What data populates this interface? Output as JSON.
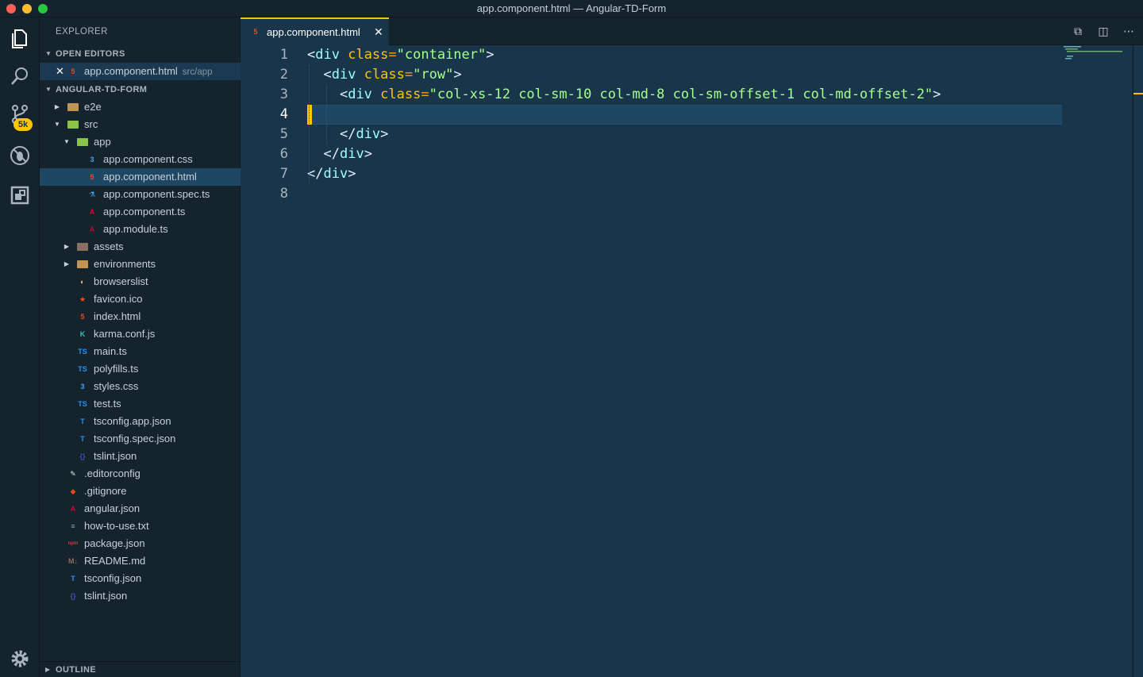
{
  "window": {
    "title": "app.component.html — Angular-TD-Form"
  },
  "activity_bar": {
    "items": [
      {
        "name": "explorer",
        "icon": "files-icon"
      },
      {
        "name": "search",
        "icon": "search-icon"
      },
      {
        "name": "source-control",
        "icon": "source-control-icon",
        "badge": "5k"
      },
      {
        "name": "debug",
        "icon": "debug-icon"
      },
      {
        "name": "extensions",
        "icon": "extensions-icon"
      }
    ],
    "manage_icon": "gear-icon"
  },
  "sidebar": {
    "title": "EXPLORER",
    "open_editors_header": "OPEN EDITORS",
    "open_editors": [
      {
        "name": "app.component.html",
        "desc": "src/app",
        "icon_text": "5",
        "icon_color": "#e44d26"
      }
    ],
    "project_header": "ANGULAR-TD-FORM",
    "outline_header": "OUTLINE",
    "tree": [
      {
        "label": "e2e",
        "depth": 1,
        "twisty": "▶",
        "icon": "folder-icon",
        "icon_text": "",
        "icon_color": "#c09553"
      },
      {
        "label": "src",
        "depth": 1,
        "twisty": "▼",
        "icon": "folder-open-icon",
        "icon_text": "",
        "icon_color": "#8bc34a"
      },
      {
        "label": "app",
        "depth": 2,
        "twisty": "▼",
        "icon": "folder-open-icon",
        "icon_text": "",
        "icon_color": "#8bc34a"
      },
      {
        "label": "app.component.css",
        "depth": 3,
        "icon": "css-icon",
        "icon_text": "3",
        "icon_color": "#42a5f5"
      },
      {
        "label": "app.component.html",
        "depth": 3,
        "icon": "html-icon",
        "icon_text": "5",
        "icon_color": "#e44d26",
        "selected": true
      },
      {
        "label": "app.component.spec.ts",
        "depth": 3,
        "icon": "test-icon",
        "icon_text": "⚗",
        "icon_color": "#42a5f5"
      },
      {
        "label": "app.component.ts",
        "depth": 3,
        "icon": "angular-icon",
        "icon_text": "A",
        "icon_color": "#dd0031"
      },
      {
        "label": "app.module.ts",
        "depth": 3,
        "icon": "angular-module-icon",
        "icon_text": "A",
        "icon_color": "#c3002f"
      },
      {
        "label": "assets",
        "depth": 2,
        "twisty": "▶",
        "icon": "folder-icon",
        "icon_text": "",
        "icon_color": "#8d6e63"
      },
      {
        "label": "environments",
        "depth": 2,
        "twisty": "▶",
        "icon": "folder-icon",
        "icon_text": "",
        "icon_color": "#c09553"
      },
      {
        "label": "browserslist",
        "depth": 2,
        "icon": "browserslist-icon",
        "icon_text": "◐",
        "icon_color": "#ffca28"
      },
      {
        "label": "favicon.ico",
        "depth": 2,
        "icon": "favicon-icon",
        "icon_text": "★",
        "icon_color": "#f4511e"
      },
      {
        "label": "index.html",
        "depth": 2,
        "icon": "html-icon",
        "icon_text": "5",
        "icon_color": "#e44d26"
      },
      {
        "label": "karma.conf.js",
        "depth": 2,
        "icon": "karma-icon",
        "icon_text": "K",
        "icon_color": "#3cbeae"
      },
      {
        "label": "main.ts",
        "depth": 2,
        "icon": "typescript-icon",
        "icon_text": "TS",
        "icon_color": "#2196f3"
      },
      {
        "label": "polyfills.ts",
        "depth": 2,
        "icon": "typescript-icon",
        "icon_text": "TS",
        "icon_color": "#2196f3"
      },
      {
        "label": "styles.css",
        "depth": 2,
        "icon": "css-icon",
        "icon_text": "3",
        "icon_color": "#42a5f5"
      },
      {
        "label": "test.ts",
        "depth": 2,
        "icon": "typescript-icon",
        "icon_text": "TS",
        "icon_color": "#2196f3"
      },
      {
        "label": "tsconfig.app.json",
        "depth": 2,
        "icon": "tsconfig-icon",
        "icon_text": "T",
        "icon_color": "#2196f3"
      },
      {
        "label": "tsconfig.spec.json",
        "depth": 2,
        "icon": "tsconfig-icon",
        "icon_text": "T",
        "icon_color": "#2196f3"
      },
      {
        "label": "tslint.json",
        "depth": 2,
        "icon": "tslint-icon",
        "icon_text": "{}",
        "icon_color": "#3f51b5"
      },
      {
        "label": ".editorconfig",
        "depth": 1,
        "icon": "editorconfig-icon",
        "icon_text": "✎",
        "icon_color": "#e0e0e0"
      },
      {
        "label": ".gitignore",
        "depth": 1,
        "icon": "git-icon",
        "icon_text": "◆",
        "icon_color": "#e64a19"
      },
      {
        "label": "angular.json",
        "depth": 1,
        "icon": "angular-icon",
        "icon_text": "A",
        "icon_color": "#dd0031"
      },
      {
        "label": "how-to-use.txt",
        "depth": 1,
        "icon": "text-file-icon",
        "icon_text": "≡",
        "icon_color": "#90a4ae"
      },
      {
        "label": "package.json",
        "depth": 1,
        "icon": "npm-icon",
        "icon_text": "npm",
        "icon_color": "#cb3837"
      },
      {
        "label": "README.md",
        "depth": 1,
        "icon": "markdown-icon",
        "icon_text": "M↓",
        "icon_color": "#8d6e63"
      },
      {
        "label": "tsconfig.json",
        "depth": 1,
        "icon": "tsconfig-icon",
        "icon_text": "T",
        "icon_color": "#2196f3"
      },
      {
        "label": "tslint.json",
        "depth": 1,
        "icon": "tslint-icon",
        "icon_text": "{}",
        "icon_color": "#3f51b5"
      }
    ]
  },
  "editor": {
    "tab": {
      "label": "app.component.html",
      "icon_text": "5",
      "icon_color": "#e44d26"
    },
    "actions": [
      {
        "name": "open-changes-icon",
        "glyph": "⧉"
      },
      {
        "name": "split-editor-icon",
        "glyph": "◫"
      },
      {
        "name": "more-actions-icon",
        "glyph": "⋯"
      }
    ],
    "lines": [
      {
        "n": "1",
        "tokens": [
          {
            "t": "punc",
            "v": "<"
          },
          {
            "t": "tag",
            "v": "div"
          },
          {
            "t": "punc",
            "v": " "
          },
          {
            "t": "attr",
            "v": "class"
          },
          {
            "t": "eq",
            "v": "="
          },
          {
            "t": "str",
            "v": "\"container\""
          },
          {
            "t": "punc",
            "v": ">"
          }
        ]
      },
      {
        "n": "2",
        "indent": 1,
        "tokens": [
          {
            "t": "punc",
            "v": "<"
          },
          {
            "t": "tag",
            "v": "div"
          },
          {
            "t": "punc",
            "v": " "
          },
          {
            "t": "attr",
            "v": "class"
          },
          {
            "t": "eq",
            "v": "="
          },
          {
            "t": "str",
            "v": "\"row\""
          },
          {
            "t": "punc",
            "v": ">"
          }
        ]
      },
      {
        "n": "3",
        "indent": 2,
        "tokens": [
          {
            "t": "punc",
            "v": "<"
          },
          {
            "t": "tag",
            "v": "div"
          },
          {
            "t": "punc",
            "v": " "
          },
          {
            "t": "attr",
            "v": "class"
          },
          {
            "t": "eq",
            "v": "="
          },
          {
            "t": "str",
            "v": "\"col-xs-12 col-sm-10 col-md-8 col-sm-offset-1 col-md-offset-2\""
          },
          {
            "t": "punc",
            "v": ">"
          }
        ]
      },
      {
        "n": "4",
        "indent": 0,
        "tokens": []
      },
      {
        "n": "5",
        "indent": 2,
        "tokens": [
          {
            "t": "punc",
            "v": "</"
          },
          {
            "t": "tag",
            "v": "div"
          },
          {
            "t": "punc",
            "v": ">"
          }
        ]
      },
      {
        "n": "6",
        "indent": 1,
        "tokens": [
          {
            "t": "punc",
            "v": "</"
          },
          {
            "t": "tag",
            "v": "div"
          },
          {
            "t": "punc",
            "v": ">"
          }
        ]
      },
      {
        "n": "7",
        "indent": 0,
        "tokens": [
          {
            "t": "punc",
            "v": "</"
          },
          {
            "t": "tag",
            "v": "div"
          },
          {
            "t": "punc",
            "v": ">"
          }
        ]
      },
      {
        "n": "8",
        "indent": 0,
        "tokens": []
      }
    ],
    "current_line": "4"
  },
  "colors": {
    "accent": "#ffc600",
    "background": "#193549",
    "sidebar": "#15232d",
    "selection": "#1f4662"
  }
}
